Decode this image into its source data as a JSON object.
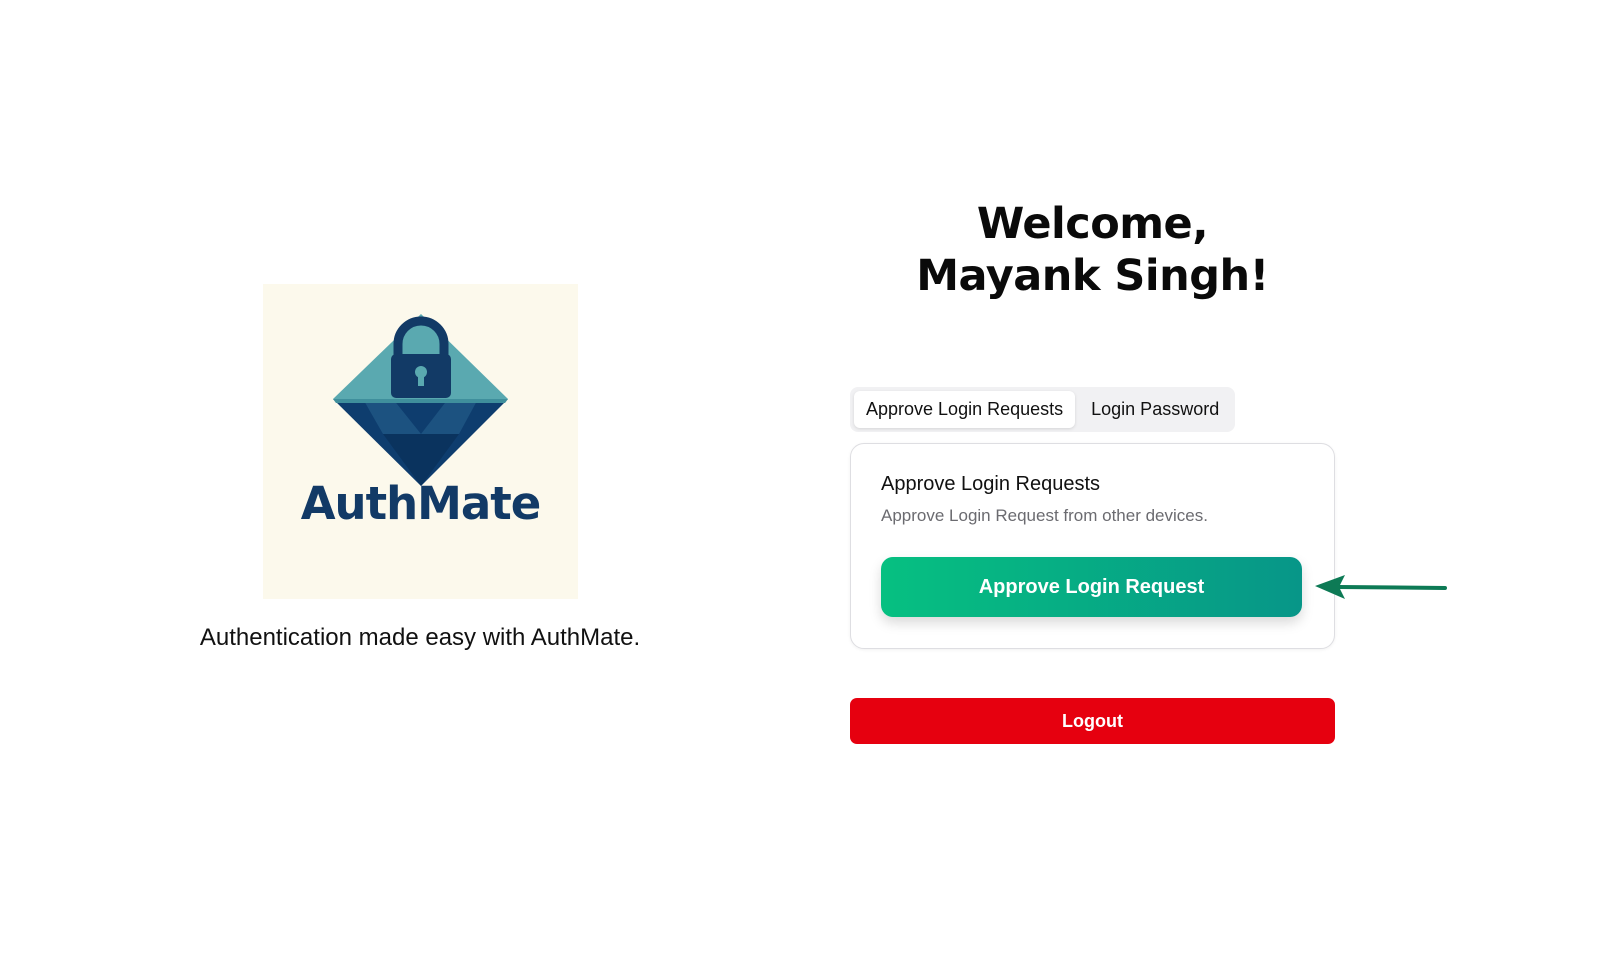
{
  "brand": {
    "logo_text": "AuthMate",
    "tagline": "Authentication made easy with AuthMate.",
    "logo_colors": {
      "background": "#fcf9ec",
      "diamond_top": "#5aa9b0",
      "diamond_bottom": "#0e3d6e",
      "lock": "#123a66"
    }
  },
  "welcome": {
    "line1": "Welcome,",
    "line2": "Mayank Singh!"
  },
  "tabs": [
    {
      "label": "Approve Login Requests",
      "active": true
    },
    {
      "label": "Login Password",
      "active": false
    }
  ],
  "card": {
    "title": "Approve Login Requests",
    "description": "Approve Login Request from other devices.",
    "button_label": "Approve Login Request"
  },
  "logout_label": "Logout",
  "annotation": {
    "icon": "arrow-left-icon",
    "color": "#0d7a55"
  },
  "colors": {
    "approve_gradient_start": "#06c081",
    "approve_gradient_end": "#079688",
    "logout": "#e6000f"
  }
}
